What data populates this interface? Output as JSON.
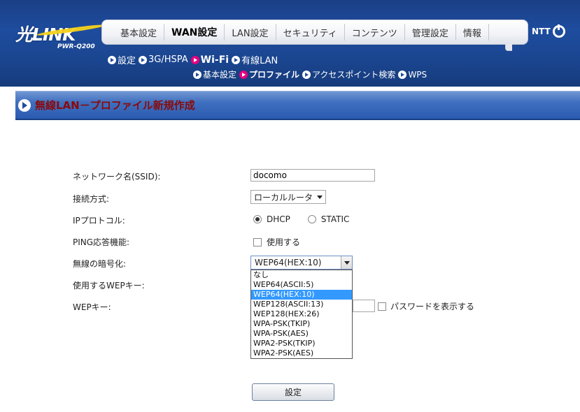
{
  "header": {
    "logo": "光LINK",
    "model": "PWR-Q200",
    "brand": "NTT",
    "tabs": [
      {
        "label": "基本設定",
        "active": false
      },
      {
        "label": "WAN設定",
        "active": true
      },
      {
        "label": "LAN設定",
        "active": false
      },
      {
        "label": "セキュリティ",
        "active": false
      },
      {
        "label": "コンテンツ",
        "active": false
      },
      {
        "label": "管理設定",
        "active": false
      },
      {
        "label": "情報",
        "active": false
      }
    ],
    "subnav1": [
      {
        "label": "設定",
        "active": false
      },
      {
        "label": "3G/HSPA",
        "active": false
      },
      {
        "label": "Wi-Fi",
        "active": true
      },
      {
        "label": "有線LAN",
        "active": false
      }
    ],
    "subnav2": [
      {
        "label": "基本設定",
        "active": false
      },
      {
        "label": "プロファイル",
        "active": true
      },
      {
        "label": "アクセスポイント検索",
        "active": false
      },
      {
        "label": "WPS",
        "active": false
      }
    ]
  },
  "page": {
    "title": "無線LAN－プロファイル新規作成"
  },
  "form": {
    "ssid_label": "ネットワーク名(SSID):",
    "ssid_value": "docomo",
    "conn_label": "接続方式:",
    "conn_value": "ローカルルータ",
    "ip_label": "IPプロトコル:",
    "ip_dhcp": "DHCP",
    "ip_static": "STATIC",
    "ping_label": "PING応答機能:",
    "ping_option": "使用する",
    "enc_label": "無線の暗号化:",
    "enc_value": "WEP64(HEX:10)",
    "enc_options": [
      "なし",
      "WEP64(ASCII:5)",
      "WEP64(HEX:10)",
      "WEP128(ASCII:13)",
      "WEP128(HEX:26)",
      "WPA-PSK(TKIP)",
      "WPA-PSK(AES)",
      "WPA2-PSK(TKIP)",
      "WPA2-PSK(AES)"
    ],
    "enc_selected_index": 2,
    "wep_use_label": "使用するWEPキー:",
    "wep_key_label": "WEPキー:",
    "show_password": "パスワードを表示する",
    "submit": "設定"
  },
  "colors": {
    "header_blue": "#1e4c9e",
    "title_red": "#8a0a0a",
    "active_pink": "#e6007e",
    "selection_blue": "#3399ff"
  }
}
